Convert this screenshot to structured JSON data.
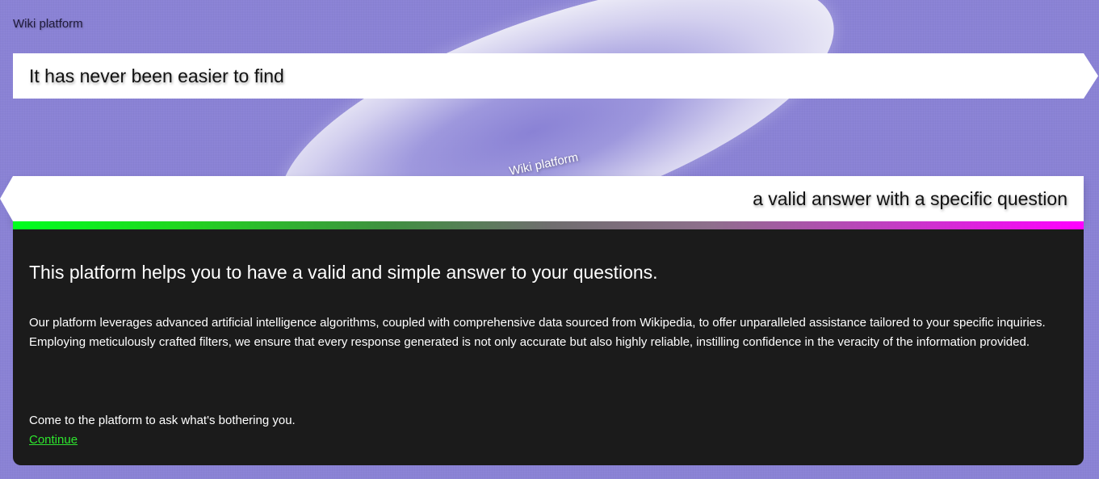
{
  "site": {
    "title": "Wiki platform"
  },
  "hero": {
    "ellipse_label": "Wiki platform",
    "banner_top": "It has never been easier to find",
    "banner_bottom": "a valid answer with a specific question"
  },
  "card": {
    "heading": "This platform helps you to have a valid and simple answer to your questions.",
    "paragraph": "Our platform leverages advanced artificial intelligence algorithms, coupled with comprehensive data sourced from Wikipedia, to offer unparalleled assistance tailored to your specific inquiries. Employing meticulously crafted filters, we ensure that every response generated is not only accurate but also highly reliable, instilling confidence in the veracity of the information provided.",
    "call_to_action": "Come to the platform to ask what's bothering you.",
    "link_label": "Continue"
  },
  "colors": {
    "background": "#8a82d5",
    "card_background": "#1b1b1b",
    "link": "#2ee62e",
    "gradient_start": "#00ff1e",
    "gradient_end": "#ff00ff"
  }
}
